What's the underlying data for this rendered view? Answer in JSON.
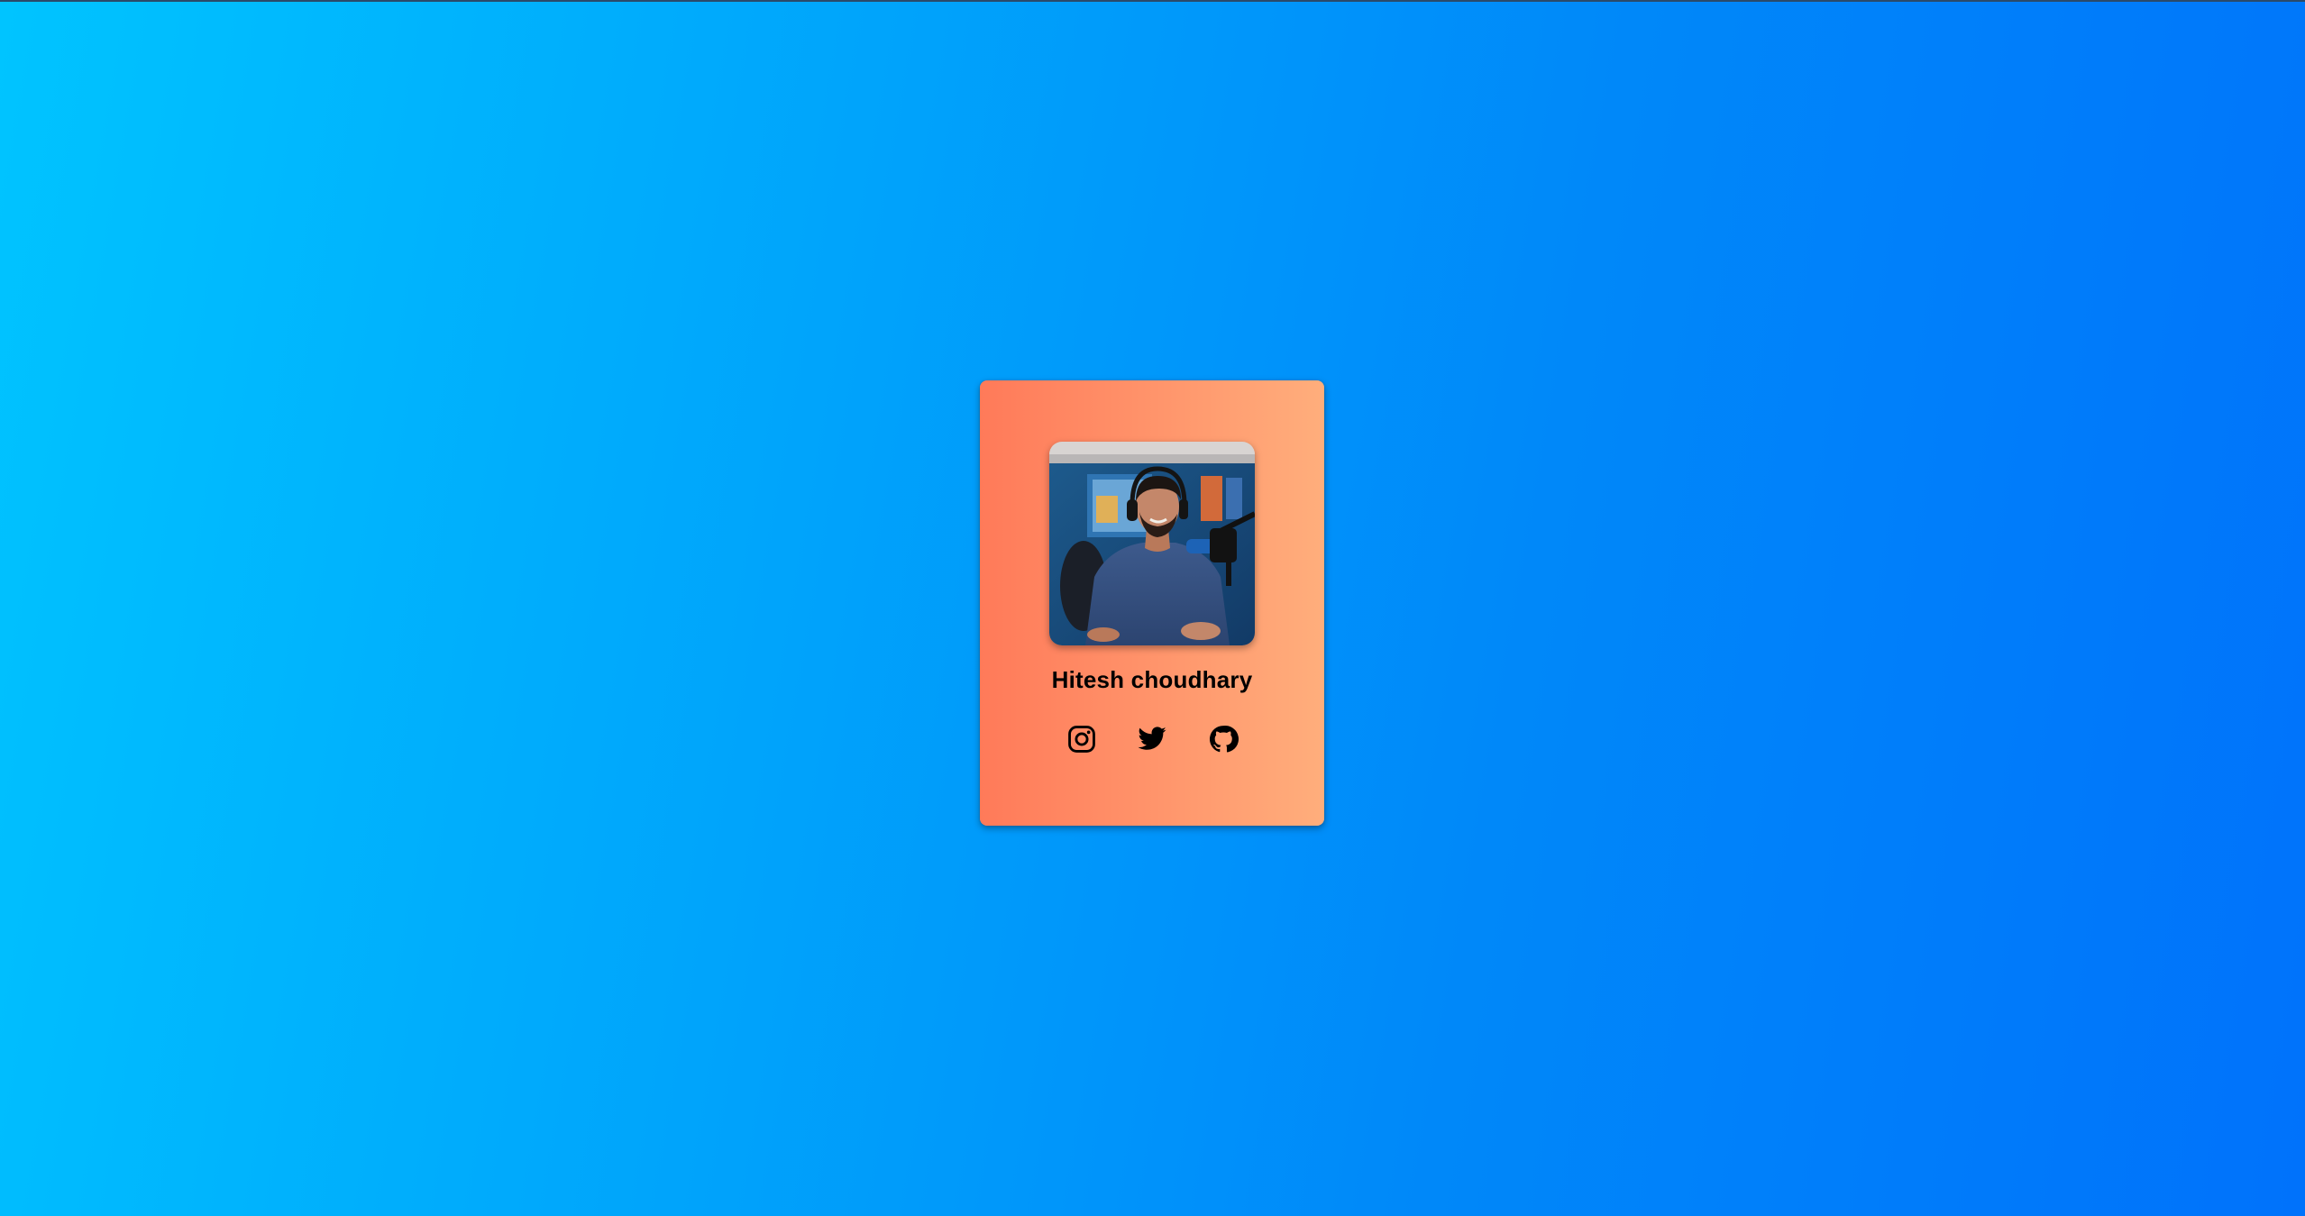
{
  "card": {
    "name": "Hitesh choudhary",
    "photo_alt": "Hitesh choudhary",
    "social_links": [
      {
        "icon": "instagram-icon"
      },
      {
        "icon": "twitter-icon"
      },
      {
        "icon": "github-icon"
      }
    ]
  },
  "colors": {
    "background_start": "#00c4ff",
    "background_end": "#0072fb",
    "card_start": "#ff7a59",
    "card_end": "#ffae7c",
    "text": "#000000"
  }
}
